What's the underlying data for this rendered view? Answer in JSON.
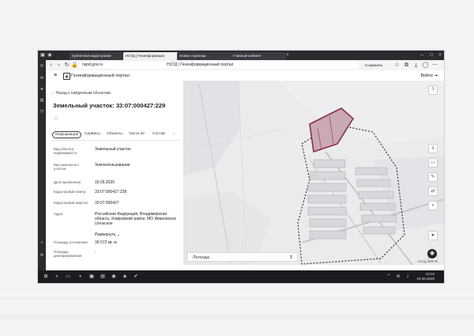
{
  "browser": {
    "tabs": [
      {
        "label": "публичная кадастровая"
      },
      {
        "label": "НСГД | Геоинформацио"
      },
      {
        "label": "Новая страница"
      },
      {
        "label": "Главный кабинет"
      }
    ],
    "url": "nspd.gov.ru",
    "page_title_bar": "НСГД | Геоинформационный портал",
    "right_labels": {
      "save": "Сохранить"
    }
  },
  "site": {
    "title": "Геоинформационный портал",
    "login": "Войти"
  },
  "panel": {
    "back": "Назад к найденным объектам",
    "heading": "Земельный участок: 33:07:000427:229",
    "tabs": [
      "Информация",
      "Сервисы",
      "Объекты",
      "Части ЗУ",
      "Состав"
    ],
    "rows": [
      {
        "label": "Вид объекта недвижимости",
        "value": "Земельный участок"
      },
      {
        "label": "Вид земельного участка",
        "value": "Землепользование"
      },
      {
        "label": "Дата присвоения",
        "value": "19.05.2025"
      },
      {
        "label": "Кадастровый номер",
        "value": "33:07:000427:229"
      },
      {
        "label": "Кадастровый квартал",
        "value": "33:07:000427"
      },
      {
        "label": "Адрес",
        "value": "Российская Федерация, Владимирская область, Ковровский район, МО Ивановское (сельское"
      },
      {
        "label": "Площадь уточненная",
        "value": "39 572 кв. м"
      },
      {
        "label": "Площадь декларированная",
        "value": "-"
      }
    ],
    "more": "Развернуть"
  },
  "map": {
    "legend": "Легенда",
    "scale": "НСГД 2025 ⊕"
  },
  "taskbar": {
    "time": "13:34",
    "date": "19.06.2025"
  }
}
